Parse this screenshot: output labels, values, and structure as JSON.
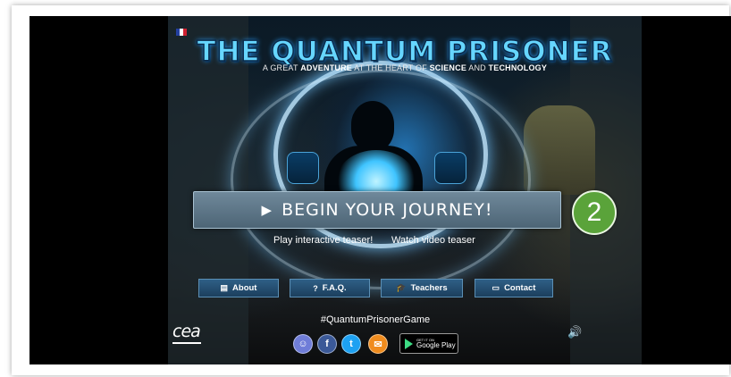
{
  "header": {
    "title": "THE QUANTUM PRISONER",
    "subtitle_parts": [
      {
        "text": "A GREAT ",
        "bold": false
      },
      {
        "text": "ADVENTURE",
        "bold": true
      },
      {
        "text": " AT THE HEART OF ",
        "bold": false
      },
      {
        "text": "SCIENCE",
        "bold": true
      },
      {
        "text": " AND ",
        "bold": false
      },
      {
        "text": "TECHNOLOGY",
        "bold": true
      }
    ]
  },
  "main": {
    "begin_label": "BEGIN YOUR JOURNEY!",
    "begin_icon": "play-icon",
    "teaser_interactive": "Play interactive teaser!",
    "teaser_video": "Watch video teaser"
  },
  "nav": {
    "about": "About",
    "faq": "F.A.Q.",
    "teachers": "Teachers",
    "contact": "Contact"
  },
  "footer": {
    "hashtag": "#QuantumPrisonerGame",
    "cea_logo": "cea",
    "google_play_small": "GET IT ON",
    "google_play_big": "Google Play",
    "social": [
      {
        "name": "discord-icon",
        "glyph": "☺",
        "color": "#6f7dd8"
      },
      {
        "name": "facebook-icon",
        "glyph": "f",
        "color": "#3b5998"
      },
      {
        "name": "twitter-icon",
        "glyph": "t",
        "color": "#1da1f2"
      },
      {
        "name": "email-icon",
        "glyph": "✉",
        "color": "#f08c1e"
      }
    ]
  },
  "annotation": {
    "badge_number": "2",
    "badge_color": "#5aa33a"
  },
  "colors": {
    "title": "#66d6ff",
    "nav_button": "#2e5f86",
    "begin_button": "#5f7a8c"
  }
}
